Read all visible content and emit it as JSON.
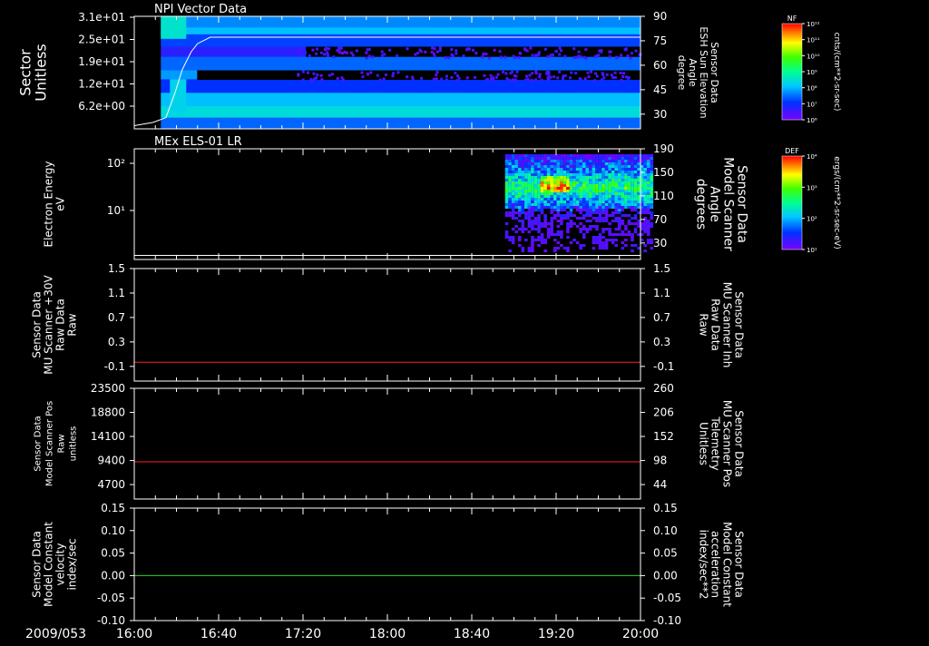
{
  "chart_data": [
    {
      "type": "heatmap",
      "title": "NPI Vector Data",
      "ylabel_left": [
        "Sector",
        "Unitless"
      ],
      "left_ticks": [
        "3.1e+01",
        "2.5e+01",
        "1.9e+01",
        "1.2e+01",
        "6.2e+00"
      ],
      "ylabel_right": [
        "Sensor Data",
        "ESH Sun Elevation",
        "Angle",
        "degree"
      ],
      "right_ticks": [
        90,
        75,
        60,
        45,
        30
      ],
      "right_range": [
        20,
        90
      ],
      "overlay_line": {
        "color": "#ffffff",
        "t": [
          16.0,
          16.15,
          16.25,
          16.32,
          16.38,
          16.45,
          16.5,
          16.6,
          16.8,
          20.0
        ],
        "v": [
          22,
          24,
          27,
          42,
          57,
          68,
          73,
          77,
          77,
          77
        ]
      },
      "colorbar": {
        "label": "NF",
        "units": "cnts/(cm**2-sr-sec)",
        "ticks": [
          "10¹²",
          "10¹¹",
          "10¹⁰",
          "10⁹",
          "10⁸",
          "10⁷",
          "10⁶"
        ]
      }
    },
    {
      "type": "heatmap",
      "title": "MEx ELS-01 LR",
      "ylabel_left": [
        "Electron Energy",
        "eV"
      ],
      "left_ticks": [
        "10²",
        "10¹"
      ],
      "ylabel_right": [
        "Sensor Data",
        "Model Scanner",
        "Angle",
        "degrees"
      ],
      "right_ticks": [
        190,
        150,
        110,
        70,
        30
      ],
      "right_range": [
        0,
        190
      ],
      "overlay_line": {
        "color": "#ffffff",
        "t": [
          16.0,
          20.0
        ],
        "v": [
          7,
          7
        ]
      },
      "data_start_time": "18:56",
      "colorbar": {
        "label": "DEF",
        "units": "ergs/(cm**2-sr-sec-eV)",
        "ticks": [
          "10⁴",
          "10³",
          "10²",
          "10¹"
        ]
      }
    },
    {
      "type": "line",
      "ylabel_left": [
        "Sensor Data",
        "MU Scanner +30V",
        "Raw Data",
        "Raw"
      ],
      "left_ticks": [
        1.5,
        1.1,
        0.7,
        0.3,
        -0.1
      ],
      "left_range": [
        -0.3,
        1.5
      ],
      "ylabel_right": [
        "Sensor Data",
        "MU Scanner Inh",
        "Raw Data",
        "Raw"
      ],
      "right_label_color": "#ff2020",
      "right_ticks": [
        1.5,
        1.1,
        0.7,
        0.3,
        -0.1
      ],
      "series": [
        {
          "color": "#ff2020",
          "t": [
            16.0,
            20.0
          ],
          "v": [
            0.0,
            0.0
          ]
        }
      ]
    },
    {
      "type": "line",
      "ylabel_left": [
        "Sensor Data",
        "Model Scanner Pos",
        "Raw",
        "unitless"
      ],
      "left_ticks": [
        23500,
        18800,
        14100,
        9400,
        4700
      ],
      "left_range": [
        0,
        23500
      ],
      "ylabel_right": [
        "Sensor Data",
        "MU Scanner Pos",
        "Telemetry",
        "Unitless"
      ],
      "right_label_color": "#ff2020",
      "right_ticks": [
        260,
        206,
        152,
        98,
        44
      ],
      "series": [
        {
          "color": "#ff2020",
          "t": [
            16.0,
            20.0
          ],
          "v": [
            7900,
            7900
          ]
        }
      ]
    },
    {
      "type": "line",
      "ylabel_left": [
        "Sensor Data",
        "Model Constant",
        "velocity",
        "index/sec"
      ],
      "left_ticks": [
        "0.15",
        "0.10",
        "0.05",
        "0.00",
        "-0.05",
        "-0.10"
      ],
      "left_range": [
        -0.1,
        0.15
      ],
      "ylabel_right": [
        "Sensor Data",
        "Model Constant",
        "acceleration",
        "index/sec**2"
      ],
      "right_label_color": "#22dd22",
      "right_ticks": [
        "0.15",
        "0.10",
        "0.05",
        "0.00",
        "-0.05",
        "-0.10"
      ],
      "series": [
        {
          "color": "#22dd22",
          "t": [
            16.0,
            20.0
          ],
          "v": [
            0.0,
            0.0
          ]
        }
      ]
    }
  ],
  "x_axis": {
    "date": "2009/053",
    "ticks": [
      "16:00",
      "16:40",
      "17:20",
      "18:00",
      "18:40",
      "19:20",
      "20:00"
    ],
    "range": [
      16.0,
      20.0
    ]
  }
}
